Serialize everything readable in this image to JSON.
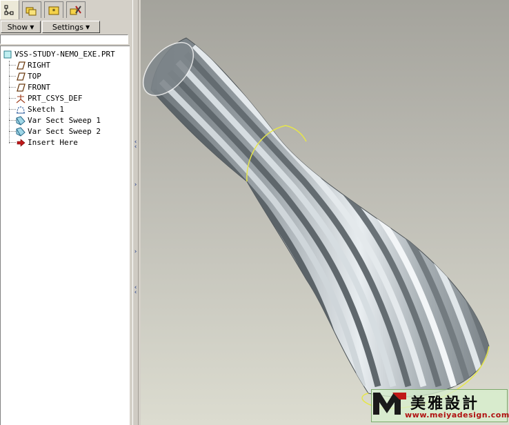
{
  "menubar": {
    "show_label": "Show",
    "settings_label": "Settings"
  },
  "tabs": [
    {
      "icon": "model-tree-icon",
      "active": true
    },
    {
      "icon": "folder-browser-icon",
      "active": false
    },
    {
      "icon": "favorites-icon",
      "active": false
    },
    {
      "icon": "connections-icon",
      "active": false
    }
  ],
  "model_tree": {
    "root": {
      "label": "VSS-STUDY-NEMO_EXE.PRT",
      "icon": "part-icon"
    },
    "items": [
      {
        "label": "RIGHT",
        "icon": "datum-plane-icon"
      },
      {
        "label": "TOP",
        "icon": "datum-plane-icon"
      },
      {
        "label": "FRONT",
        "icon": "datum-plane-icon"
      },
      {
        "label": "PRT_CSYS_DEF",
        "icon": "coordinate-system-icon"
      },
      {
        "label": "Sketch 1",
        "icon": "sketch-icon"
      },
      {
        "label": "Var Sect Sweep 1",
        "icon": "sweep-icon"
      },
      {
        "label": "Var Sect Sweep 2",
        "icon": "sweep-icon"
      },
      {
        "label": "Insert Here",
        "icon": "insert-arrow-icon"
      }
    ]
  },
  "watermark": {
    "chinese": "美雅設計",
    "url": "www.meiyadesign.com"
  },
  "colors": {
    "selection_edge": "#e6e64a",
    "surface_dark": "#7a8287",
    "surface_light": "#e8edf0",
    "watermark_url": "#b01010",
    "splitter_arrow": "#1f3a8a"
  }
}
